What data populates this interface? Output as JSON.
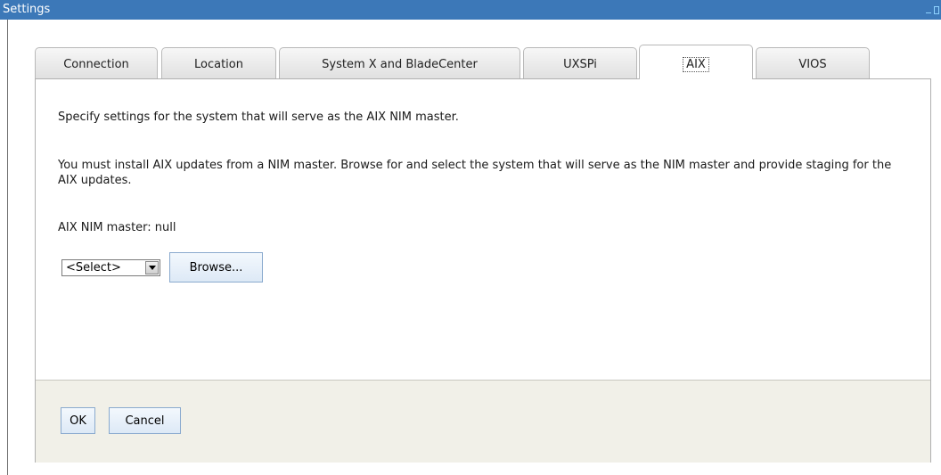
{
  "window": {
    "title": "Settings"
  },
  "tabs": [
    {
      "label": "Connection",
      "active": false
    },
    {
      "label": "Location",
      "active": false
    },
    {
      "label": "System X and BladeCenter",
      "active": false
    },
    {
      "label": "UXSPi",
      "active": false
    },
    {
      "label": "AIX",
      "active": true
    },
    {
      "label": "VIOS",
      "active": false
    }
  ],
  "content": {
    "intro": "Specify settings for the system that will serve as the AIX NIM master.",
    "description": "You must install AIX updates from a NIM master. Browse for and select the system that will serve as the NIM master and provide staging for the AIX updates.",
    "master_label": "AIX NIM master: null",
    "select_value": "<Select>",
    "browse_label": "Browse..."
  },
  "footer": {
    "ok_label": "OK",
    "cancel_label": "Cancel"
  },
  "colors": {
    "titlebar": "#3c78b8",
    "footer_bg": "#f1f0e8",
    "button_border": "#8aaace"
  }
}
